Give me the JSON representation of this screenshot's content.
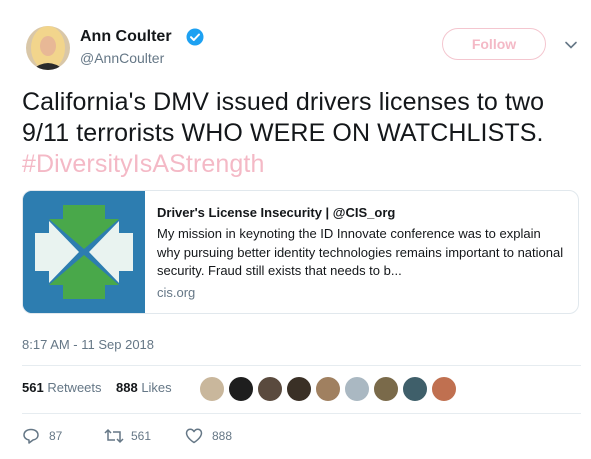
{
  "author": {
    "name": "Ann Coulter",
    "handle": "@AnnCoulter",
    "verified_icon": "verified-badge-icon",
    "avatar_icon": "profile-photo"
  },
  "follow_label": "Follow",
  "menu_icon": "chevron-down-icon",
  "tweet": {
    "text": "California's DMV issued drivers licenses to two 9/11 terrorists WHO WERE ON WATCHLISTS.",
    "hashtag": "#DiversityIsAStrength"
  },
  "card": {
    "title": "Driver's License Insecurity | @CIS_org",
    "description": "My mission in keynoting the ID Innovate conference was to explain why pursuing better identity technologies remains important to national security. Fraud still exists that needs to b...",
    "domain": "cis.org",
    "image_icon": "cis-logo"
  },
  "timestamp": "8:17 AM - 11 Sep 2018",
  "stats": {
    "retweets_count": "561",
    "retweets_label": "Retweets",
    "likes_count": "888",
    "likes_label": "Likes"
  },
  "actions": {
    "replies": "87",
    "retweets": "561",
    "likes": "888"
  },
  "colors": {
    "text": "#14171a",
    "secondary": "#657786",
    "hashtag": "#f4b9c6",
    "follow_border": "#f4c6cf",
    "verified": "#1da1f2",
    "card_blue": "#2d7db0",
    "card_green": "#49a84a"
  }
}
